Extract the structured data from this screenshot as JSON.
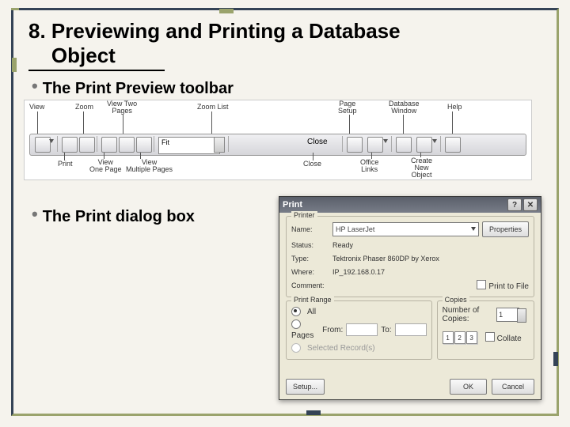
{
  "title_line1": "8. Previewing and Printing a Database",
  "title_line2": "Object",
  "bullet1": "The Print Preview toolbar",
  "bullet2": "The Print dialog box",
  "toolbar": {
    "labels": {
      "view": "View",
      "print": "Print",
      "zoom": "Zoom",
      "onePage": "View\nOne Page",
      "twoPages": "View Two\nPages",
      "multiPages": "View\nMultiple Pages",
      "zoomList": "Zoom List",
      "fit": "Fit",
      "close": "Close",
      "closeLabel": "Close",
      "pageSetup": "Page\nSetup",
      "officeLinks": "Office\nLinks",
      "dbWindow": "Database\nWindow",
      "createNew": "Create\nNew\nObject",
      "help": "Help"
    }
  },
  "dialog": {
    "title": "Print",
    "printer_group": "Printer",
    "name_label": "Name:",
    "name_value": "HP LaserJet",
    "properties": "Properties",
    "status_label": "Status:",
    "status_value": "Ready",
    "type_label": "Type:",
    "type_value": "Tektronix Phaser 860DP by Xerox",
    "where_label": "Where:",
    "where_value": "IP_192.168.0.17",
    "comment_label": "Comment:",
    "print_to_file": "Print to File",
    "range_group": "Print Range",
    "all": "All",
    "pages": "Pages",
    "from": "From:",
    "to": "To:",
    "selected": "Selected Record(s)",
    "copies_group": "Copies",
    "num_copies": "Number of Copies:",
    "copies_value": "1",
    "page_nums": [
      "1",
      "2",
      "3"
    ],
    "collate": "Collate",
    "setup": "Setup...",
    "ok": "OK",
    "cancel": "Cancel"
  }
}
